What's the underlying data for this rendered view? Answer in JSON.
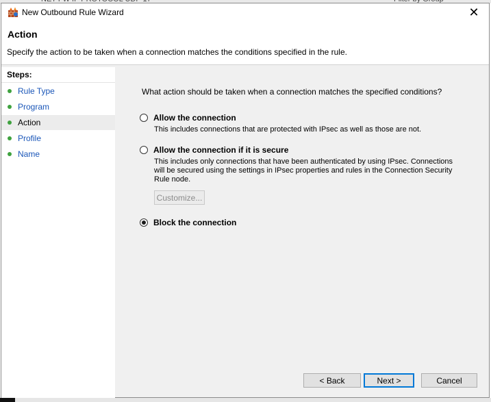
{
  "window": {
    "title": "New Outbound Rule Wizard"
  },
  "header": {
    "title": "Action",
    "description": "Specify the action to be taken when a connection matches the conditions specified in the rule."
  },
  "steps": {
    "title": "Steps:",
    "items": [
      {
        "label": "Rule Type"
      },
      {
        "label": "Program"
      },
      {
        "label": "Action"
      },
      {
        "label": "Profile"
      },
      {
        "label": "Name"
      }
    ],
    "current_index": 2
  },
  "content": {
    "question": "What action should be taken when a connection matches the specified conditions?",
    "options": [
      {
        "label": "Allow the connection",
        "description": "This includes connections that are protected with IPsec as well as those are not.",
        "selected": false
      },
      {
        "label": "Allow the connection if it is secure",
        "description": "This includes only connections that have been authenticated by using IPsec.  Connections will be secured using the settings in IPsec properties and rules in the Connection Security Rule node.",
        "selected": false
      },
      {
        "label": "Block the connection",
        "description": "",
        "selected": true
      }
    ],
    "customize_label": "Customize..."
  },
  "buttons": {
    "back": "< Back",
    "next": "Next >",
    "cancel": "Cancel"
  },
  "colors": {
    "step_dot": "#3fa23f",
    "step_link": "#1a56b8",
    "default_button_border": "#0078d7"
  }
}
